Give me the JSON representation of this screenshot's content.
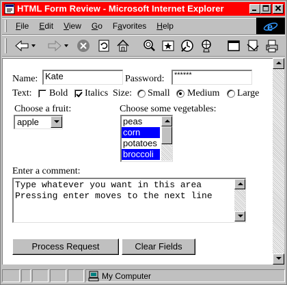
{
  "window": {
    "title": "HTML Form Review - Microsoft Internet Explorer",
    "title_bar_color": "#ff0000",
    "controls": {
      "minimize": "_",
      "maximize": "□",
      "close": "×"
    }
  },
  "menu": {
    "items": [
      {
        "access": "F",
        "rest": "ile"
      },
      {
        "access": "E",
        "rest": "dit"
      },
      {
        "access": "V",
        "rest": "iew"
      },
      {
        "access": "G",
        "rest": "o"
      },
      {
        "access": "a",
        "pre": "F",
        "rest": "vorites"
      },
      {
        "access": "H",
        "rest": "elp"
      }
    ]
  },
  "toolbar": {
    "icons": [
      "back-icon",
      "forward-icon",
      "stop-icon",
      "refresh-icon",
      "home-icon",
      "search-icon",
      "favorites-icon",
      "history-icon",
      "channels-icon",
      "fullscreen-icon",
      "mail-icon",
      "print-icon"
    ]
  },
  "form": {
    "name_label": "Name:",
    "name_value": "Kate",
    "password_label": "Password:",
    "password_value": "******",
    "text_label": "Text:",
    "bold_label": "Bold",
    "bold_checked": false,
    "italics_label": "Italics",
    "italics_checked": true,
    "size_label": "Size:",
    "size_options": [
      "Small",
      "Medium",
      "Large"
    ],
    "size_selected": "Medium",
    "fruit_label": "Choose a fruit:",
    "fruit_selected": "apple",
    "veg_label": "Choose some vegetables:",
    "veg_options": [
      {
        "label": "peas",
        "selected": false
      },
      {
        "label": "corn",
        "selected": true
      },
      {
        "label": "potatoes",
        "selected": false
      },
      {
        "label": "broccoli",
        "selected": true
      }
    ],
    "comment_label": "Enter a comment:",
    "comment_lines": [
      "Type whatever you want in this area",
      "Pressing enter moves to the next line"
    ],
    "submit_label": "Process Request",
    "reset_label": "Clear Fields"
  },
  "status": {
    "zone": "My Computer"
  }
}
